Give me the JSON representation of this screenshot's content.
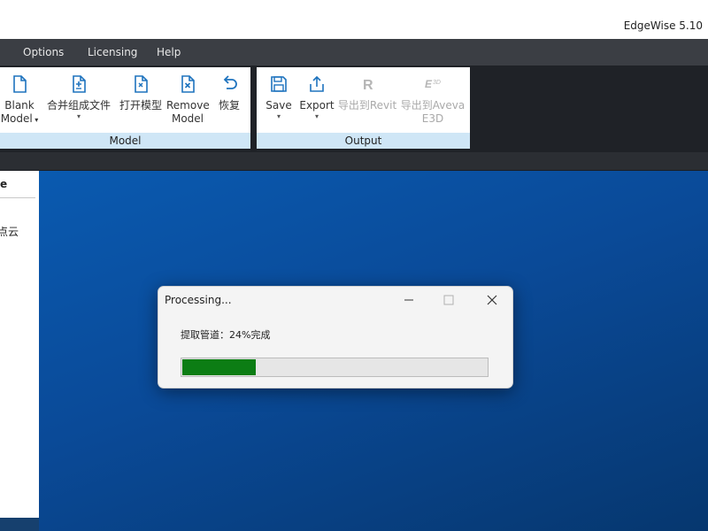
{
  "window": {
    "title": "EdgeWise 5.10"
  },
  "menu": {
    "items": [
      "Options",
      "Licensing",
      "Help"
    ]
  },
  "ribbon": {
    "model_group": {
      "label": "Model",
      "buttons": [
        {
          "label1": "Blank",
          "label2": "Model",
          "icon": "blank-document-icon",
          "dropdown": true
        },
        {
          "label1": "合并组成文件",
          "label2": "",
          "icon": "merge-document-icon",
          "dropdown": true
        },
        {
          "label1": "打开模型",
          "label2": "",
          "icon": "open-model-icon"
        },
        {
          "label1": "Remove",
          "label2": "Model",
          "icon": "remove-document-icon"
        },
        {
          "label1": "恢复",
          "label2": "",
          "icon": "undo-arrow-icon"
        }
      ]
    },
    "output_group": {
      "label": "Output",
      "buttons": [
        {
          "label1": "Save",
          "label2": "",
          "icon": "save-icon",
          "dropdown": true
        },
        {
          "label1": "Export",
          "label2": "",
          "icon": "export-icon",
          "dropdown": true
        },
        {
          "label1": "导出到Revit",
          "label2": "",
          "icon": "revit-icon",
          "disabled": true
        },
        {
          "label1": "导出到Aveva",
          "label2": "E3D",
          "icon": "e3d-icon",
          "disabled": true
        }
      ]
    }
  },
  "left_panel": {
    "header": "e",
    "item": "点云"
  },
  "dialog": {
    "title": "Processing...",
    "message": "提取管道：24%完成",
    "progress": 0.24,
    "progress_color": "#0c7d14"
  },
  "colors": {
    "accent_blue": "#1e73be",
    "canvas_blue": "#0a4a98",
    "ribbon_label_bg": "#cfe6f6"
  }
}
